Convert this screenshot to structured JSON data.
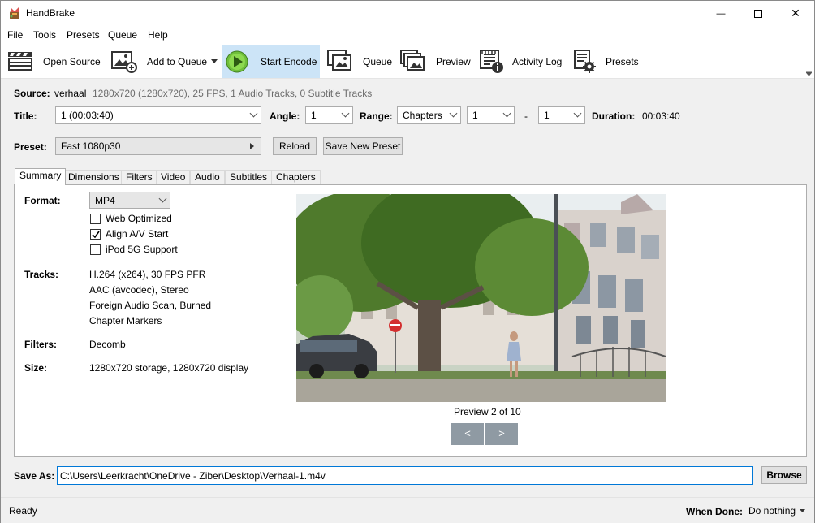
{
  "window": {
    "title": "HandBrake",
    "minimize_glyph": "—",
    "close_glyph": "✕"
  },
  "menu": {
    "items": [
      "File",
      "Tools",
      "Presets",
      "Queue",
      "Help"
    ]
  },
  "toolbar": {
    "open_source": "Open Source",
    "add_to_queue": "Add to Queue",
    "start_encode": "Start Encode",
    "queue": "Queue",
    "preview": "Preview",
    "activity_log": "Activity Log",
    "presets": "Presets"
  },
  "source": {
    "label": "Source:",
    "name": "verhaal",
    "info": "1280x720 (1280x720), 25 FPS, 1 Audio Tracks, 0 Subtitle Tracks"
  },
  "title_row": {
    "title_label": "Title:",
    "title_value": "1  (00:03:40)",
    "angle_label": "Angle:",
    "angle_value": "1",
    "range_label": "Range:",
    "range_type": "Chapters",
    "range_start": "1",
    "range_sep": "-",
    "range_end": "1",
    "duration_label": "Duration:",
    "duration_value": "00:03:40"
  },
  "preset": {
    "label": "Preset:",
    "value": "Fast 1080p30",
    "reload": "Reload",
    "save_new": "Save New Preset"
  },
  "tabs": [
    "Summary",
    "Dimensions",
    "Filters",
    "Video",
    "Audio",
    "Subtitles",
    "Chapters"
  ],
  "summary": {
    "format_label": "Format:",
    "format_value": "MP4",
    "web_optimized": "Web Optimized",
    "align_av": "Align A/V Start",
    "ipod": "iPod 5G Support",
    "tracks_label": "Tracks:",
    "tracks": [
      "H.264 (x264), 30 FPS PFR",
      "AAC (avcodec), Stereo",
      "Foreign Audio Scan, Burned",
      "Chapter Markers"
    ],
    "filters_label": "Filters:",
    "filters_value": "Decomb",
    "size_label": "Size:",
    "size_value": "1280x720 storage, 1280x720 display",
    "preview_caption": "Preview 2 of 10",
    "prev_glyph": "<",
    "next_glyph": ">"
  },
  "save_as": {
    "label": "Save As:",
    "path": "C:\\Users\\Leerkracht\\OneDrive - Ziber\\Desktop\\Verhaal-1.m4v",
    "browse": "Browse"
  },
  "status": {
    "text": "Ready",
    "when_done_label": "When Done:",
    "when_done_value": "Do nothing"
  }
}
